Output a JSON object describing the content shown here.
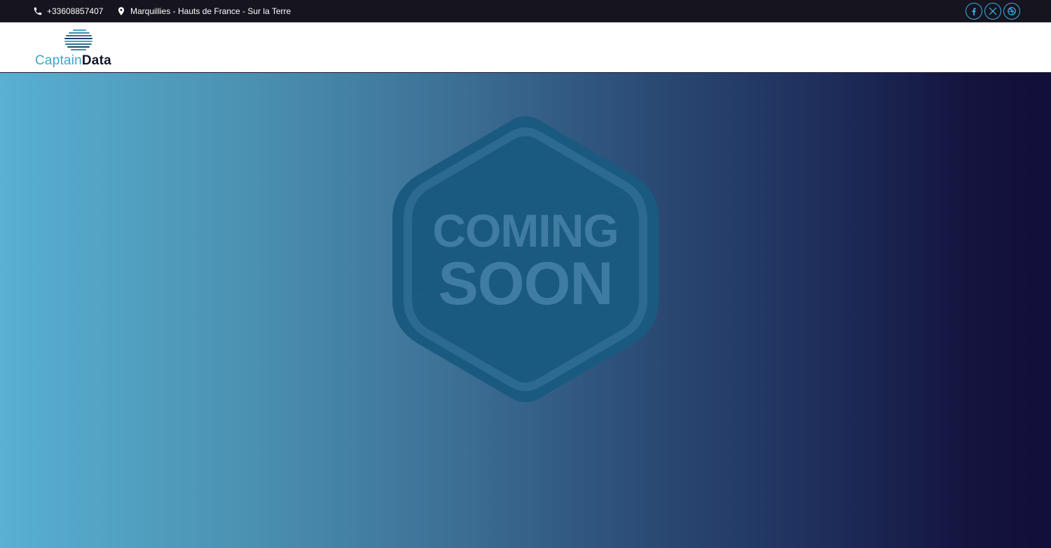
{
  "topbar": {
    "phone": "+33608857407",
    "location": "Marquillies - Hauts de France - Sur la Terre",
    "phone_icon": "phone-icon",
    "location_icon": "map-pin-icon",
    "socials": [
      {
        "name": "facebook-icon"
      },
      {
        "name": "x-twitter-icon"
      },
      {
        "name": "dribbble-icon"
      }
    ]
  },
  "logo": {
    "part1": "Captain",
    "part2": "Data"
  },
  "hero": {
    "badge_line1": "COMING",
    "badge_line2": "SOON"
  },
  "colors": {
    "topbar_bg": "#15141f",
    "accent": "#3fb1e5",
    "logo_light": "#3fa6c7",
    "logo_dark": "#15152a",
    "badge": "#1b5a80",
    "badge_text": "#3f7ba2"
  }
}
